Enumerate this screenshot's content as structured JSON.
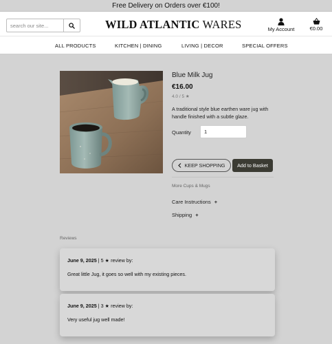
{
  "banner": {
    "text": "Free Delivery on Orders over €100!"
  },
  "header": {
    "search_placeholder": "search our site...",
    "logo_bold": "WILD ATLANTIC",
    "logo_rest": "WARES",
    "account_label": "My Account",
    "cart_total": "€0.00"
  },
  "nav": {
    "items": [
      {
        "label": "ALL PRODUCTS"
      },
      {
        "label": "KITCHEN | DINING"
      },
      {
        "label": "LIVING | DECOR"
      },
      {
        "label": "SPECIAL OFFERS"
      }
    ]
  },
  "product": {
    "title": "Blue Milk Jug",
    "price": "€16.00",
    "rating": "4.0 / 5",
    "description": "A traditional style blue earthen ware jug with handle finished with a subtle glaze.",
    "quantity_label": "Quantity",
    "quantity_value": "1",
    "keep_shopping_label": "KEEP SHOPPING",
    "add_to_basket_label": "Add to Basket",
    "more_link": "More Cups & Mugs",
    "care_label": "Care Instructions",
    "shipping_label": "Shipping"
  },
  "reviews": {
    "heading": "Reviews",
    "items": [
      {
        "date": "June 9, 2025",
        "rating": "5",
        "by_label": "review by:",
        "text": "Great little Jug, it goes so well with my existing pieces."
      },
      {
        "date": "June 9, 2025",
        "rating": "3",
        "by_label": "review by:",
        "text": "Very useful jug well made!"
      }
    ]
  },
  "colors": {
    "page_bg": "#d3d3d3",
    "header_bg": "#ffffff",
    "primary_button": "#3b3b33"
  },
  "icons": {
    "search": "search-icon",
    "account": "user-icon",
    "cart": "basket-icon",
    "back": "chevron-left-icon",
    "star": "star-icon"
  }
}
